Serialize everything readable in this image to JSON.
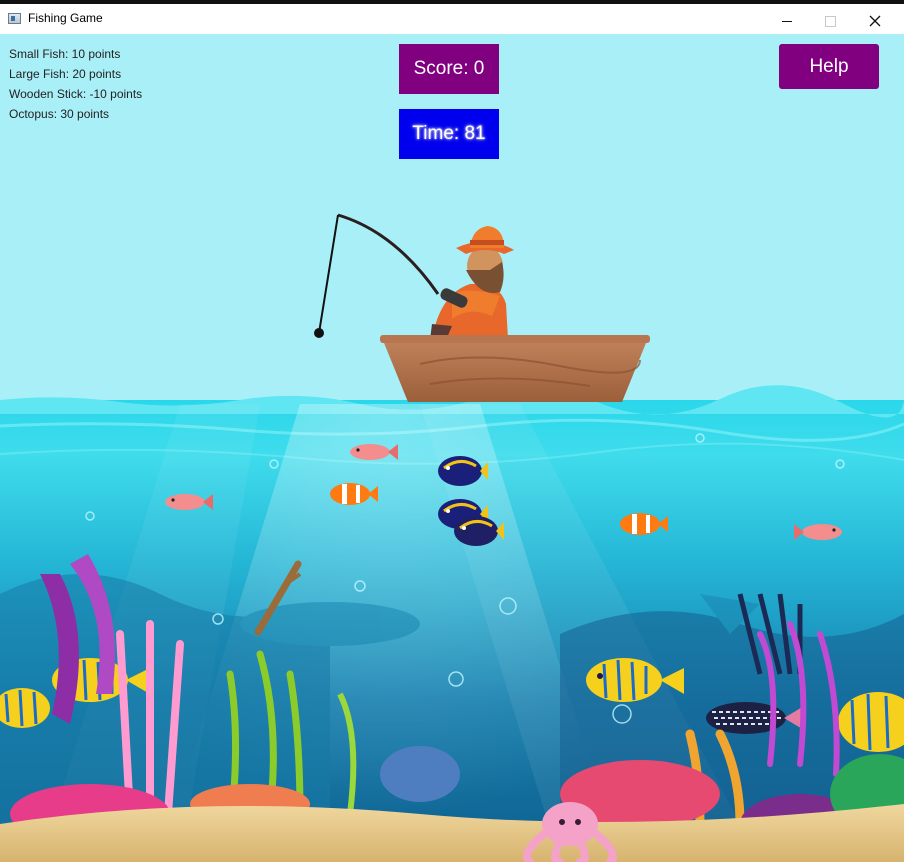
{
  "window": {
    "title": "Fishing Game",
    "icon": "app-window-icon",
    "controls": [
      "minimize-icon",
      "maximize-icon",
      "close-icon"
    ]
  },
  "legend": {
    "items": [
      "Small Fish: 10 points",
      "Large Fish: 20 points",
      "Wooden Stick: -10 points",
      "Octopus: 30 points"
    ]
  },
  "score": {
    "label": "Score: 0",
    "value": 0
  },
  "time": {
    "label": "Time: 81",
    "value": 81
  },
  "help": {
    "label": "Help"
  },
  "colors": {
    "sky": "#a9eff8",
    "score_bg": "#800080",
    "time_bg": "#0000ee",
    "help_bg": "#800080",
    "water_top": "#1fc9df",
    "water_deep": "#0f6f9a",
    "sand": "#e9c98a"
  },
  "scene": {
    "fisherman": "fisherman-in-boat",
    "fish_icons": [
      "clownfish-icon",
      "blue-tang-icon",
      "snapper-icon",
      "angelfish-icon",
      "striped-fish-icon"
    ],
    "hazards": [
      "wooden-stick-icon"
    ],
    "creatures": [
      "octopus-icon"
    ]
  }
}
